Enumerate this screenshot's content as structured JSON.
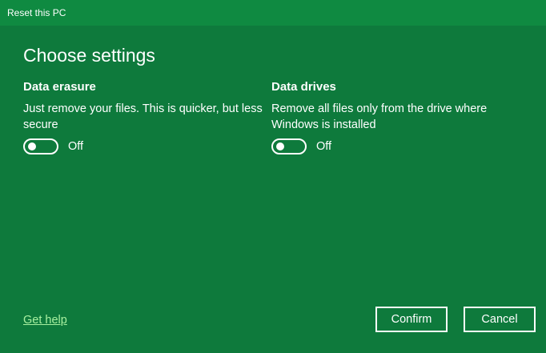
{
  "window": {
    "title": "Reset this PC"
  },
  "page": {
    "heading": "Choose settings"
  },
  "settings": [
    {
      "title": "Data erasure",
      "description": "Just remove your files. This is quicker, but less secure",
      "toggle_state": "Off",
      "toggle_on": false
    },
    {
      "title": "Data drives",
      "description": "Remove all files only from the drive where Windows is installed",
      "toggle_state": "Off",
      "toggle_on": false
    }
  ],
  "footer": {
    "help_link": "Get help",
    "confirm_label": "Confirm",
    "cancel_label": "Cancel"
  },
  "colors": {
    "background": "#0e7a3c",
    "titlebar": "#0f8a41",
    "link": "#a8f0a0",
    "text": "#ffffff"
  }
}
